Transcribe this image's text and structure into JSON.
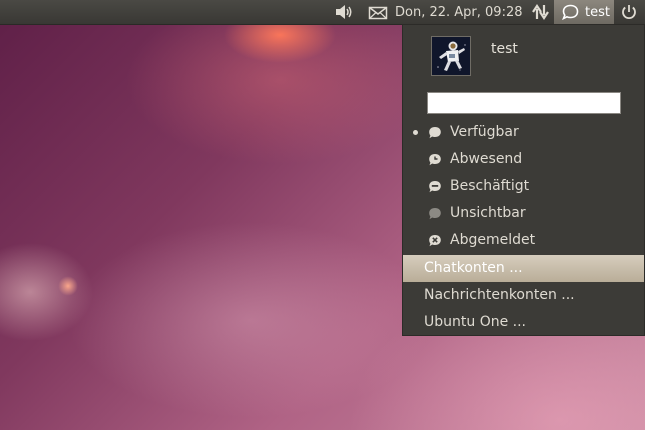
{
  "panel": {
    "clock": "Don, 22. Apr, 09:28",
    "user": "test",
    "icons": [
      "speaker-icon",
      "envelope-icon",
      "network-updown-icon",
      "chat-bubble-icon",
      "power-icon"
    ]
  },
  "menu": {
    "user_name": "test",
    "status_placeholder": "",
    "statuses": [
      {
        "label": "Verfügbar",
        "icon": "status-available-icon",
        "active": true
      },
      {
        "label": "Abwesend",
        "icon": "status-away-icon",
        "active": false
      },
      {
        "label": "Beschäftigt",
        "icon": "status-busy-icon",
        "active": false
      },
      {
        "label": "Unsichtbar",
        "icon": "status-invisible-icon",
        "active": false
      },
      {
        "label": "Abgemeldet",
        "icon": "status-offline-icon",
        "active": false
      }
    ],
    "accounts": [
      {
        "label": "Chatkonten ...",
        "highlighted": true
      },
      {
        "label": "Nachrichtenkonten ..."
      },
      {
        "label": "Ubuntu One ..."
      }
    ]
  },
  "colors": {
    "panel_bg": "#3c3b37",
    "menu_bg": "#3c3b37",
    "highlight": "#c7bca9"
  }
}
